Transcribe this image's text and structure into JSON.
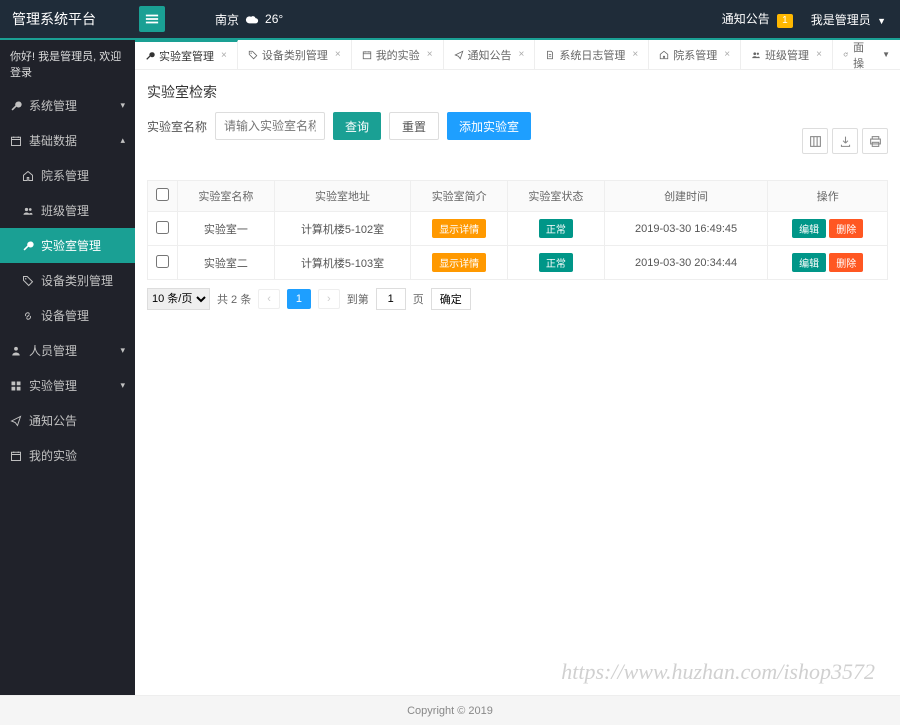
{
  "header": {
    "logo": "管理系统平台",
    "weather_city": "南京",
    "weather_temp": "26°",
    "notice_label": "通知公告",
    "notice_count": "1",
    "user_label": "我是管理员"
  },
  "sidebar": {
    "greeting": "你好! 我是管理员, 欢迎登录",
    "items": [
      {
        "label": "系统管理",
        "icon": "wrench",
        "expand": true
      },
      {
        "label": "基础数据",
        "icon": "calendar",
        "expand": true,
        "open": true
      },
      {
        "label": "院系管理",
        "icon": "home",
        "sub": true
      },
      {
        "label": "班级管理",
        "icon": "users",
        "sub": true
      },
      {
        "label": "实验室管理",
        "icon": "wrench",
        "sub": true,
        "active": true
      },
      {
        "label": "设备类别管理",
        "icon": "tag",
        "sub": true
      },
      {
        "label": "设备管理",
        "icon": "link",
        "sub": true
      },
      {
        "label": "人员管理",
        "icon": "user",
        "expand": true
      },
      {
        "label": "实验管理",
        "icon": "grid",
        "expand": true
      },
      {
        "label": "通知公告",
        "icon": "send"
      },
      {
        "label": "我的实验",
        "icon": "calendar"
      }
    ]
  },
  "tabs": [
    {
      "label": "实验室管理",
      "icon": "wrench",
      "active": true
    },
    {
      "label": "设备类别管理",
      "icon": "tag"
    },
    {
      "label": "我的实验",
      "icon": "calendar"
    },
    {
      "label": "通知公告",
      "icon": "send"
    },
    {
      "label": "系统日志管理",
      "icon": "doc"
    },
    {
      "label": "院系管理",
      "icon": "home"
    },
    {
      "label": "班级管理",
      "icon": "users"
    }
  ],
  "tabs_op": "页面操作",
  "page": {
    "title": "实验室检索",
    "search_label": "实验室名称",
    "search_placeholder": "请输入实验室名称",
    "btn_query": "查询",
    "btn_reset": "重置",
    "btn_add": "添加实验室"
  },
  "table": {
    "headers": [
      "",
      "实验室名称",
      "实验室地址",
      "实验室简介",
      "实验室状态",
      "创建时间",
      "操作"
    ],
    "rows": [
      {
        "name": "实验室一",
        "addr": "计算机楼5-102室",
        "detail": "显示详情",
        "status": "正常",
        "time": "2019-03-30 16:49:45"
      },
      {
        "name": "实验室二",
        "addr": "计算机楼5-103室",
        "detail": "显示详情",
        "status": "正常",
        "time": "2019-03-30 20:34:44"
      }
    ],
    "op_edit": "编辑",
    "op_del": "删除"
  },
  "pager": {
    "page_size": "10 条/页",
    "total": "共 2 条",
    "current": "1",
    "goto_label": "到第",
    "goto_page": "1",
    "page_unit": "页",
    "confirm": "确定"
  },
  "footer": "Copyright © 2019",
  "watermark": "https://www.huzhan.com/ishop3572"
}
